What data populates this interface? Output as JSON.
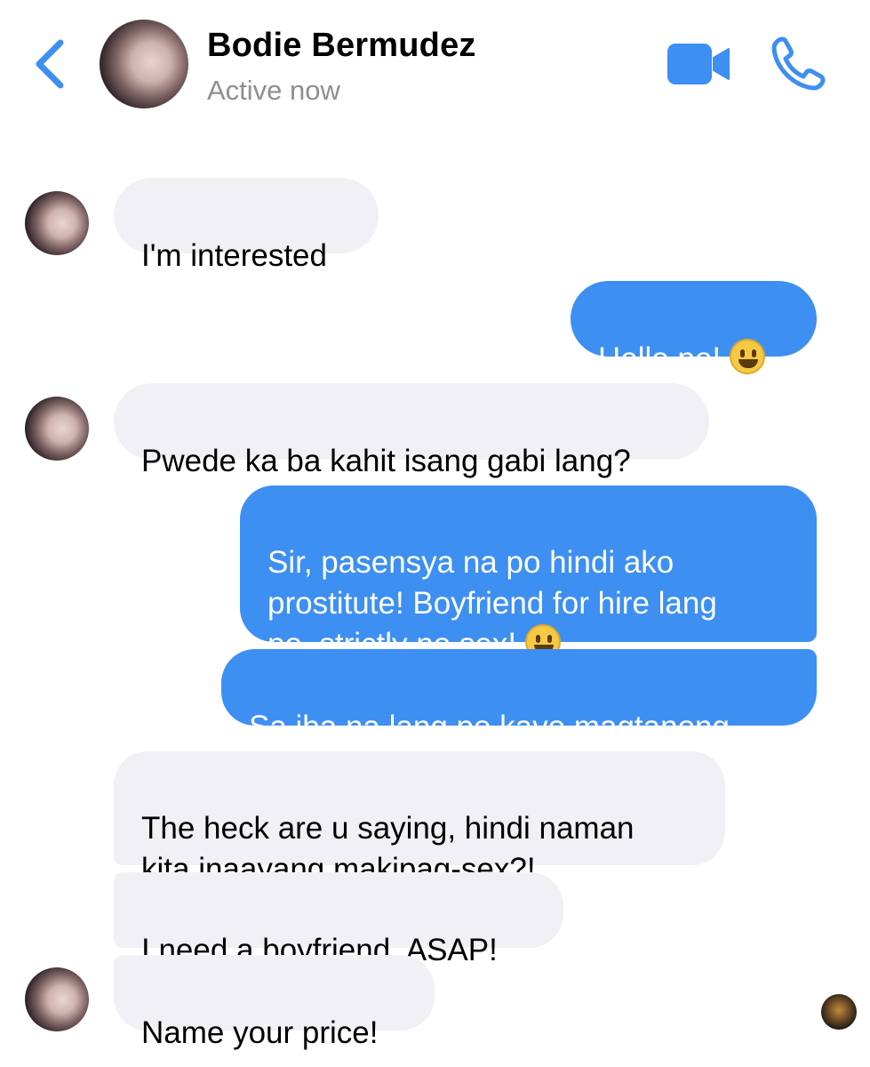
{
  "header": {
    "contact_name": "Bodie Bermudez",
    "status": "Active now",
    "back_icon": "chevron-left-icon",
    "video_icon": "video-camera-icon",
    "phone_icon": "phone-icon"
  },
  "colors": {
    "accent": "#3d8ff2",
    "incoming_bubble": "#f1f0f5",
    "status_text": "#8e8e93"
  },
  "messages": [
    {
      "from": "contact",
      "text": "I'm interested"
    },
    {
      "from": "me",
      "text": "Hello po!",
      "emoji": "grinning-face"
    },
    {
      "from": "contact",
      "text": "Pwede ka ba kahit isang gabi lang?"
    },
    {
      "from": "me",
      "text": "Sir, pasensya na po hindi ako\nprostitute! Boyfriend for hire lang\npo, strictly no sex!",
      "emoji": "grinning-face-with-sweat"
    },
    {
      "from": "me",
      "text": "Sa iba na lang po kayo magtanong."
    },
    {
      "from": "contact",
      "text": "The heck are u saying, hindi naman\nkita inaayang makipag-sex?!"
    },
    {
      "from": "contact",
      "text": "I need a boyfriend, ASAP!"
    },
    {
      "from": "contact",
      "text": "Name your price!"
    }
  ]
}
